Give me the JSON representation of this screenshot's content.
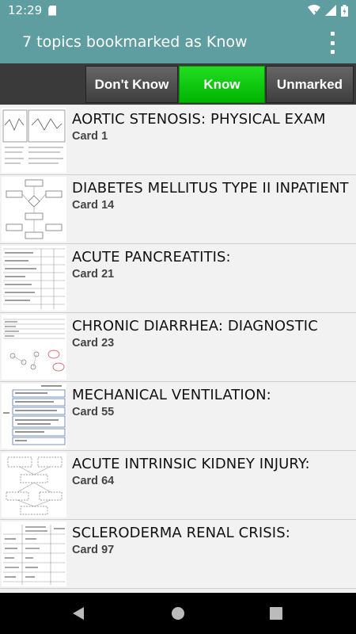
{
  "status_bar": {
    "time": "12:29"
  },
  "app_bar": {
    "title": "7 topics bookmarked as Know"
  },
  "filters": [
    {
      "label": "Don't Know",
      "selected": false
    },
    {
      "label": "Know",
      "selected": true
    },
    {
      "label": "Unmarked",
      "selected": false
    }
  ],
  "topics": [
    {
      "title": "AORTIC STENOSIS: PHYSICAL EXAM",
      "card": "Card 1"
    },
    {
      "title": "DIABETES MELLITUS TYPE II INPATIENT",
      "card": "Card 14"
    },
    {
      "title": "ACUTE PANCREATITIS:",
      "card": "Card 21"
    },
    {
      "title": "CHRONIC DIARRHEA: DIAGNOSTIC",
      "card": "Card 23"
    },
    {
      "title": "MECHANICAL VENTILATION:",
      "card": "Card 55"
    },
    {
      "title": "ACUTE INTRINSIC KIDNEY INJURY:",
      "card": "Card 64"
    },
    {
      "title": "SCLERODERMA RENAL CRISIS:",
      "card": "Card 97"
    }
  ],
  "colors": {
    "app_bar": "#5f9ea0",
    "know_green": "#00c000",
    "filter_gray": "#4a4a4a"
  }
}
